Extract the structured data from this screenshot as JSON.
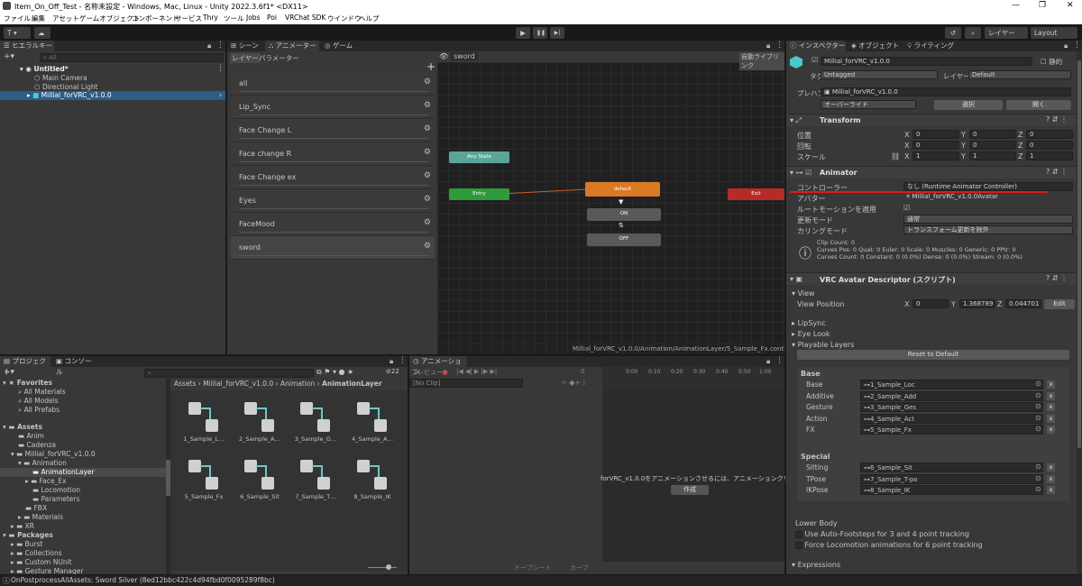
{
  "window": {
    "title": "Item_On_Off_Test - 名称未設定 - Windows, Mac, Linux - Unity 2022.3.6f1* <DX11>",
    "minimize": "—",
    "maximize": "❐",
    "close": "✕"
  },
  "menu": [
    "ファイル",
    "編集",
    "アセット",
    "ゲームオブジェクト",
    "コンポーネント",
    "サービス",
    "Thry",
    "ツール",
    "Jobs",
    "Poi",
    "VRChat SDK",
    "ウインドウ",
    "ヘルプ"
  ],
  "toolbar": {
    "account": "T ▾",
    "play": "▶",
    "pause": "❚❚",
    "step": "▶|",
    "layers": "レイヤー",
    "layout": "Layout"
  },
  "hierarchy": {
    "tab": "ヒエラルキー",
    "search_placeholder": "All",
    "scene": "Untitled*",
    "items": [
      "Main Camera",
      "Directional Light",
      "Millial_forVRC_v1.0.0"
    ]
  },
  "center_tabs": [
    "シーン",
    "アニメーター",
    "ゲーム"
  ],
  "animator": {
    "subtabs": [
      "レイヤー",
      "パラメーター"
    ],
    "breadcrumb": "sword",
    "auto_layout": "自動ライブリンク",
    "layers": [
      "all",
      "Lip_Sync",
      "Face Change L",
      "Face change R",
      "Face Change ex",
      "Eyes",
      "FaceMood",
      "sword"
    ],
    "nodes": {
      "any_state": "Any State",
      "entry": "Entry",
      "default": "default",
      "on": "ON",
      "off": "OFF",
      "exit": "Exit"
    },
    "path": "Millial_forVRC_v1.0.0/Animation/AnimationLayer/5_Sample_Fx.controller"
  },
  "project": {
    "tabs": [
      "プロジェクト",
      "コンソール"
    ],
    "favorites": "Favorites",
    "fav_items": [
      "All Materials",
      "All Models",
      "All Prefabs"
    ],
    "assets": "Assets",
    "asset_items": [
      "Anim",
      "Cadenza",
      "Millial_forVRC_v1.0.0",
      "Animation",
      "AnimationLayer",
      "Face_Ex",
      "Locomotion",
      "Parameters",
      "FBX",
      "Materials",
      "XR"
    ],
    "packages": "Packages",
    "package_items": [
      "Burst",
      "Collections",
      "Custom NUnit",
      "Gesture Manager"
    ],
    "breadcrumb": [
      "Assets",
      "Millial_forVRC_v1.0.0",
      "Animation",
      "AnimationLayer"
    ],
    "files": [
      "1_Sample_L…",
      "2_Sample_A…",
      "3_Sample_G…",
      "4_Sample_A…",
      "5_Sample_Fx",
      "6_Sample_Sit",
      "7_Sample_T…",
      "8_Sample_IK"
    ],
    "count": "22"
  },
  "animation": {
    "tab": "アニメーション",
    "preview": "プレビュー",
    "frame": "0",
    "clip": "[No Clip]",
    "message": "forVRC_v1.0.0をアニメーションさせるには、アニメーションクリップを作",
    "create": "作成",
    "dopesheet": "ドープシート",
    "curves": "カーブ",
    "ticks": [
      "0:00",
      "0:10",
      "0:20",
      "0:30",
      "0:40",
      "0:50",
      "1:00"
    ]
  },
  "status": {
    "text": "OnPostprocessAllAssets: Sword Silver (8ed12bbc422c4d94fbd0f0095289f8bc)"
  },
  "inspector": {
    "tabs": [
      "インスペクター",
      "オブジェクト",
      "ライティング"
    ],
    "name": "Millial_forVRC_v1.0.0",
    "static": "静的",
    "tag_label": "タグ",
    "tag": "Untagged",
    "layer_label": "レイヤー",
    "layer": "Default",
    "prefab_label": "プレハブ",
    "prefab": "Millial_forVRC_v1.0.0",
    "override": "オーバーライド",
    "select": "選択",
    "open": "開く",
    "transform": {
      "title": "Transform",
      "pos": "位置",
      "rot": "回転",
      "scale": "スケール",
      "x": "X",
      "y": "Y",
      "z": "Z",
      "p": [
        "0",
        "0",
        "0"
      ],
      "r": [
        "0",
        "0",
        "0"
      ],
      "s": [
        "1",
        "1",
        "1"
      ]
    },
    "animator": {
      "title": "Animator",
      "controller_label": "コントローラー",
      "controller": "なし (Runtime Animator Controller)",
      "avatar_label": "アバター",
      "avatar": "Millial_forVRC_v1.0.0Avatar",
      "root_label": "ルートモーションを適用",
      "update_label": "更新モード",
      "update": "通常",
      "culling_label": "カリングモード",
      "culling": "トランスフォーム更新を除外",
      "info": [
        "Clip Count: 0",
        "Curves Pos: 0 Quat: 0 Euler: 0 Scale: 0 Muscles: 0 Generic: 0 PPtr: 0",
        "Curves Count: 0 Constant: 0 (0.0%) Dense: 0 (0.0%) Stream: 0 (0.0%)"
      ]
    },
    "vrc": {
      "title": "VRC Avatar Descriptor (スクリプト)",
      "view": "View",
      "view_pos": "View Position",
      "vx": "0",
      "vy": "1.368789",
      "vz": "0.044701",
      "edit": "Edit",
      "lipsync": "LipSync",
      "eyelook": "Eye Look",
      "playable": "Playable Layers",
      "reset": "Reset to Default",
      "base": "Base",
      "base_slots": [
        {
          "label": "Base",
          "value": "1_Sample_Loc"
        },
        {
          "label": "Additive",
          "value": "2_Sample_Add"
        },
        {
          "label": "Gesture",
          "value": "3_Sample_Ges"
        },
        {
          "label": "Action",
          "value": "4_Sample_Act"
        },
        {
          "label": "FX",
          "value": "5_Sample_Fx"
        }
      ],
      "special": "Special",
      "special_slots": [
        {
          "label": "Sitting",
          "value": "6_Sample_Sit"
        },
        {
          "label": "TPose",
          "value": "7_Sample_T-po"
        },
        {
          "label": "IKPose",
          "value": "8_Sample_IK"
        }
      ],
      "lower": "Lower Body",
      "auto_foot": "Use Auto-Footsteps for 3 and 4 point tracking",
      "force_loco": "Force Locomotion animations for 6 point tracking",
      "expressions": "Expressions"
    }
  }
}
